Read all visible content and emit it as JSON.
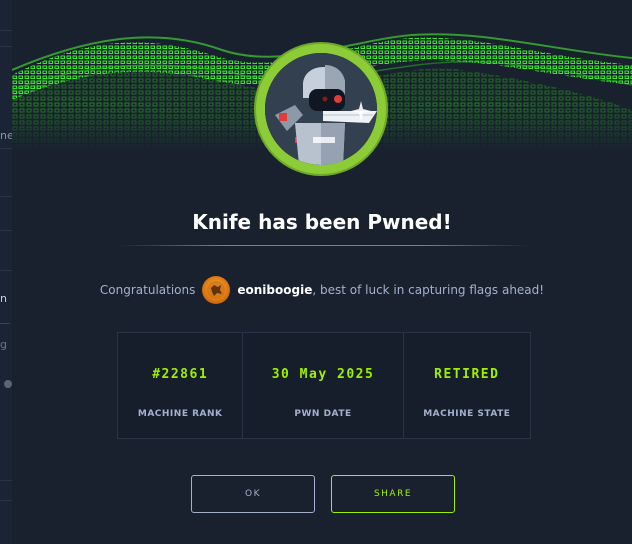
{
  "background": {
    "partial_text_1": "ne",
    "partial_text_2": "n",
    "partial_text_3": "g"
  },
  "modal": {
    "machine_avatar_icon": "robot-machine-avatar",
    "title": "Knife has been Pwned!",
    "congrats": {
      "prefix": "Congratulations",
      "username": "eoniboogie",
      "suffix": ", best of luck in capturing flags ahead!"
    },
    "stats": [
      {
        "value": "#22861",
        "label": "MACHINE RANK"
      },
      {
        "value": "30 May 2025",
        "label": "PWN DATE"
      },
      {
        "value": "RETIRED",
        "label": "MACHINE STATE"
      }
    ],
    "buttons": {
      "ok": "OK",
      "share": "SHARE"
    }
  },
  "colors": {
    "accent": "#9fef00",
    "ring": "#8ccc36",
    "text_muted": "#a4b1cd",
    "background": "#19212f"
  }
}
